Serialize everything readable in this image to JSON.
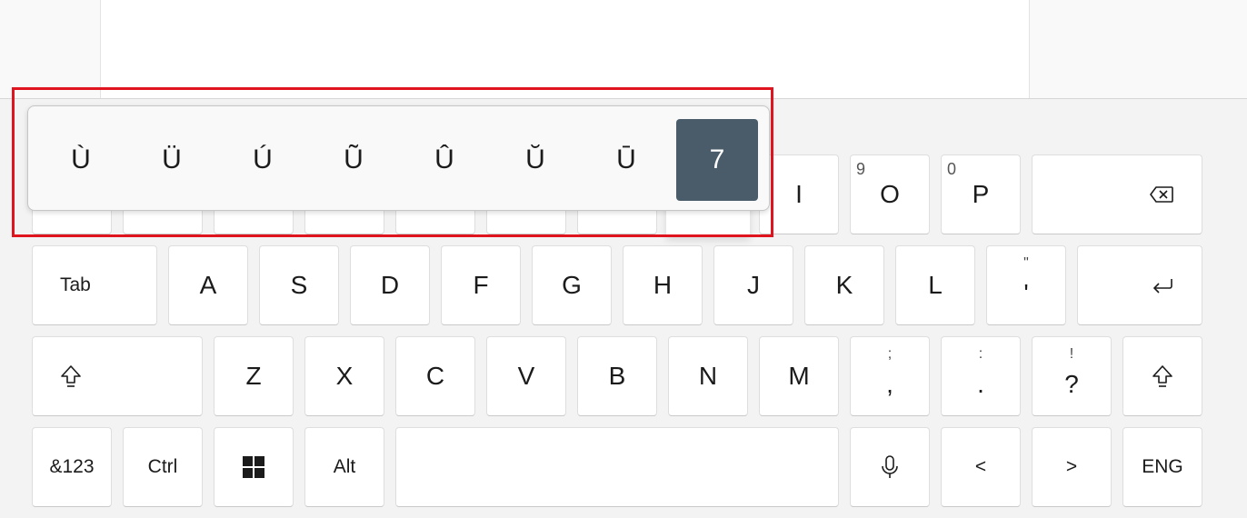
{
  "popup": {
    "chars": [
      "Ù",
      "Ü",
      "Ú",
      "Ũ",
      "Û",
      "Ŭ",
      "Ū",
      "7"
    ],
    "selected_index": 7
  },
  "row1": {
    "i": "I",
    "o": "O",
    "o_hint": "9",
    "p": "P",
    "p_hint": "0",
    "backspace_icon": "backspace-icon"
  },
  "row2": {
    "tab": "Tab",
    "keys": [
      "A",
      "S",
      "D",
      "F",
      "G",
      "H",
      "J",
      "K",
      "L"
    ],
    "apos": "'",
    "apos_above": "\"",
    "enter_icon": "enter-icon"
  },
  "row3": {
    "shift_icon": "shift-icon",
    "keys": [
      "Z",
      "X",
      "C",
      "V",
      "B",
      "N",
      "M"
    ],
    "comma": ",",
    "comma_above": ";",
    "period": ".",
    "period_above": ":",
    "question": "?",
    "question_above": "!"
  },
  "row4": {
    "sym": "&123",
    "ctrl": "Ctrl",
    "windows_icon": "windows-icon",
    "alt": "Alt",
    "mic_icon": "microphone-icon",
    "left": "<",
    "right": ">",
    "lang": "ENG"
  },
  "colors": {
    "selected_bg": "#4a5c6a",
    "highlight_border": "#e0141e",
    "key_bg": "#ffffff",
    "keyboard_bg": "#f3f3f3"
  }
}
